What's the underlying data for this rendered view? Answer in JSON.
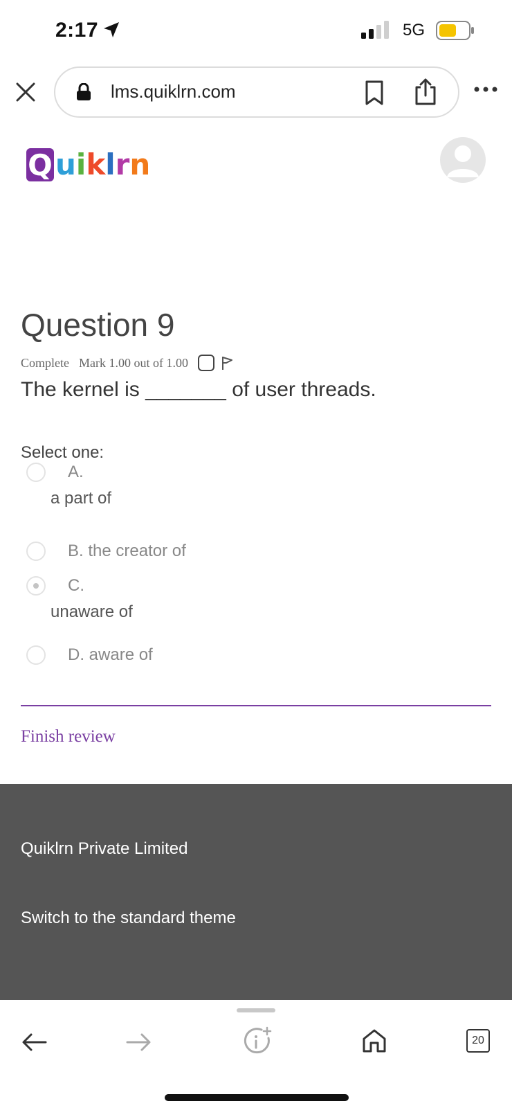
{
  "status_bar": {
    "time": "2:17",
    "network": "5G",
    "battery_color": "#f5c400"
  },
  "browser": {
    "url": "lms.quiklrn.com",
    "tab_count": "20"
  },
  "site": {
    "logo_letters": [
      "Q",
      "u",
      "i",
      "k",
      "l",
      "r",
      "n"
    ]
  },
  "question": {
    "title": "Question 9",
    "state": "Complete",
    "mark": "Mark 1.00 out of 1.00",
    "text": "The kernel is _______ of user threads.",
    "prompt": "Select one:",
    "options": [
      {
        "letter": "A.",
        "text": "a part of",
        "selected": false
      },
      {
        "letter": "B.",
        "text": "the creator of",
        "selected": false
      },
      {
        "letter": "C.",
        "text": "unaware of",
        "selected": true
      },
      {
        "letter": "D.",
        "text": "aware of",
        "selected": false
      }
    ],
    "option_b_full": "B. the creator of",
    "option_d_full": "D. aware of"
  },
  "navigation": {
    "finish_review": "Finish review"
  },
  "footer": {
    "company": "Quiklrn Private Limited",
    "theme_link": "Switch to the standard theme"
  },
  "colors": {
    "accent": "#7a3fa2",
    "footer_bg": "#555555"
  }
}
